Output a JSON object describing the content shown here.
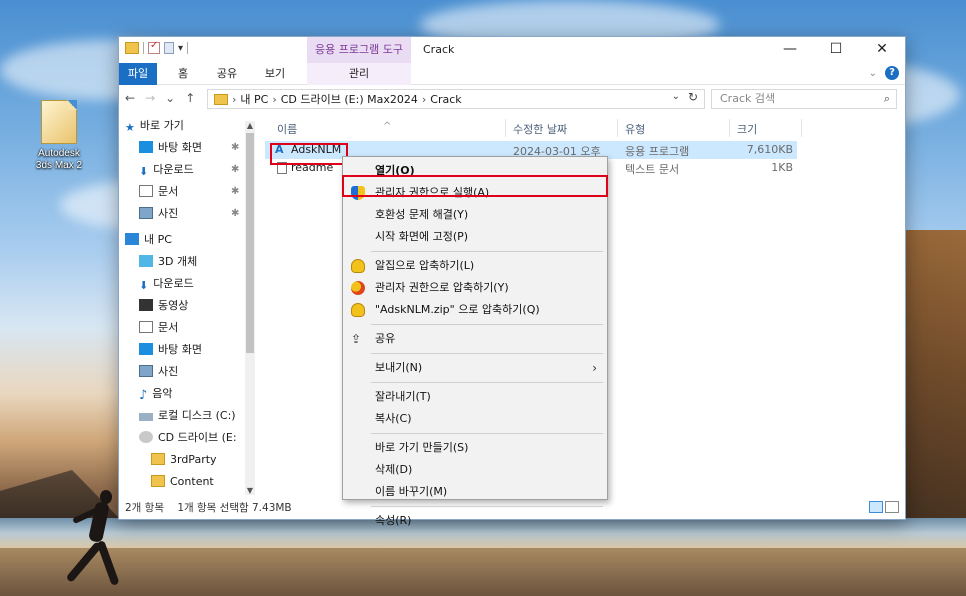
{
  "desktop": {
    "icon_label_1": "Autodesk",
    "icon_label_2": "3ds Max 2"
  },
  "window": {
    "title": "Crack",
    "contextual_tab_group": "응용 프로그램 도구",
    "controls": {
      "minimize": "—",
      "maximize": "☐",
      "close": "✕"
    }
  },
  "ribbon": {
    "tabs": [
      {
        "label": "파일"
      },
      {
        "label": "홈"
      },
      {
        "label": "공유"
      },
      {
        "label": "보기"
      },
      {
        "label": "관리"
      }
    ],
    "expand": "⌄",
    "help": "?"
  },
  "navigation": {
    "back": "←",
    "forward": "→",
    "recent": "⌄",
    "up": "↑"
  },
  "address": {
    "segments": [
      "내 PC",
      "CD 드라이브 (E:) Max2024",
      "Crack"
    ],
    "separator": "›",
    "dropdown": "⌄",
    "refresh": "↻"
  },
  "search": {
    "placeholder": "Crack 검색",
    "icon": "search-icon"
  },
  "nav_pane": {
    "items": [
      {
        "label": "바로 가기",
        "icon": "star-icon",
        "pinned": false
      },
      {
        "label": "바탕 화면",
        "icon": "desktop-icon",
        "pinned": true
      },
      {
        "label": "다운로드",
        "icon": "download-icon",
        "pinned": true
      },
      {
        "label": "문서",
        "icon": "documents-icon",
        "pinned": true
      },
      {
        "label": "사진",
        "icon": "pictures-icon",
        "pinned": true
      },
      {
        "label": "내 PC",
        "icon": "pc-icon",
        "pinned": false
      },
      {
        "label": "3D 개체",
        "icon": "cube-icon",
        "pinned": false
      },
      {
        "label": "다운로드",
        "icon": "download-icon",
        "pinned": false
      },
      {
        "label": "동영상",
        "icon": "video-icon",
        "pinned": false
      },
      {
        "label": "문서",
        "icon": "documents-icon",
        "pinned": false
      },
      {
        "label": "바탕 화면",
        "icon": "desktop-icon",
        "pinned": false
      },
      {
        "label": "사진",
        "icon": "pictures-icon",
        "pinned": false
      },
      {
        "label": "음악",
        "icon": "music-icon",
        "pinned": false
      },
      {
        "label": "로컬 디스크 (C:)",
        "icon": "drive-icon",
        "pinned": false
      },
      {
        "label": "CD 드라이브 (E:",
        "icon": "cd-drive-icon",
        "pinned": false
      },
      {
        "label": "3rdParty",
        "icon": "folder-icon",
        "pinned": false
      },
      {
        "label": "Content",
        "icon": "folder-icon",
        "pinned": false
      }
    ],
    "pin_glyph": "📌"
  },
  "columns": {
    "name": "이름",
    "date": "수정한 날짜",
    "type": "유형",
    "size": "크기"
  },
  "files": [
    {
      "name": "AdskNLM",
      "date": "2024-03-01 오후",
      "type": "응용 프로그램",
      "size": "7,610KB",
      "selected": true
    },
    {
      "name": "readme",
      "date": "",
      "type": "텍스트 문서",
      "size": "1KB",
      "selected": false
    }
  ],
  "status": {
    "count": "2개 항목",
    "selection": "1개 항목 선택함 7.43MB"
  },
  "context_menu": {
    "items": [
      {
        "label": "열기(O)",
        "bold": true,
        "icon": ""
      },
      {
        "label": "관리자 권한으로 실행(A)",
        "icon": "uac-shield-icon",
        "highlighted": true
      },
      {
        "label": "호환성 문제 해결(Y)",
        "icon": ""
      },
      {
        "label": "시작 화면에 고정(P)",
        "icon": ""
      },
      {
        "sep": true
      },
      {
        "label": "알집으로 압축하기(L)",
        "icon": "alzip-icon"
      },
      {
        "label": "관리자 권한으로 압축하기(Y)",
        "icon": "alzip-admin-icon"
      },
      {
        "label": "\"AdskNLM.zip\" 으로 압축하기(Q)",
        "icon": "alzip-icon"
      },
      {
        "sep": true
      },
      {
        "label": "공유",
        "icon": "share-icon"
      },
      {
        "sep": true
      },
      {
        "label": "보내기(N)",
        "icon": "",
        "submenu": true
      },
      {
        "sep": true
      },
      {
        "label": "잘라내기(T)",
        "icon": ""
      },
      {
        "label": "복사(C)",
        "icon": ""
      },
      {
        "sep": true
      },
      {
        "label": "바로 가기 만들기(S)",
        "icon": ""
      },
      {
        "label": "삭제(D)",
        "icon": ""
      },
      {
        "label": "이름 바꾸기(M)",
        "icon": ""
      },
      {
        "sep": true
      },
      {
        "label": "속성(R)",
        "icon": ""
      }
    ],
    "submenu_arrow": "›"
  },
  "colors": {
    "accent": "#1a6fc4",
    "selection": "#cce8ff",
    "contextual_tab": "#eaddf3",
    "highlight_box": "#e0001a"
  }
}
